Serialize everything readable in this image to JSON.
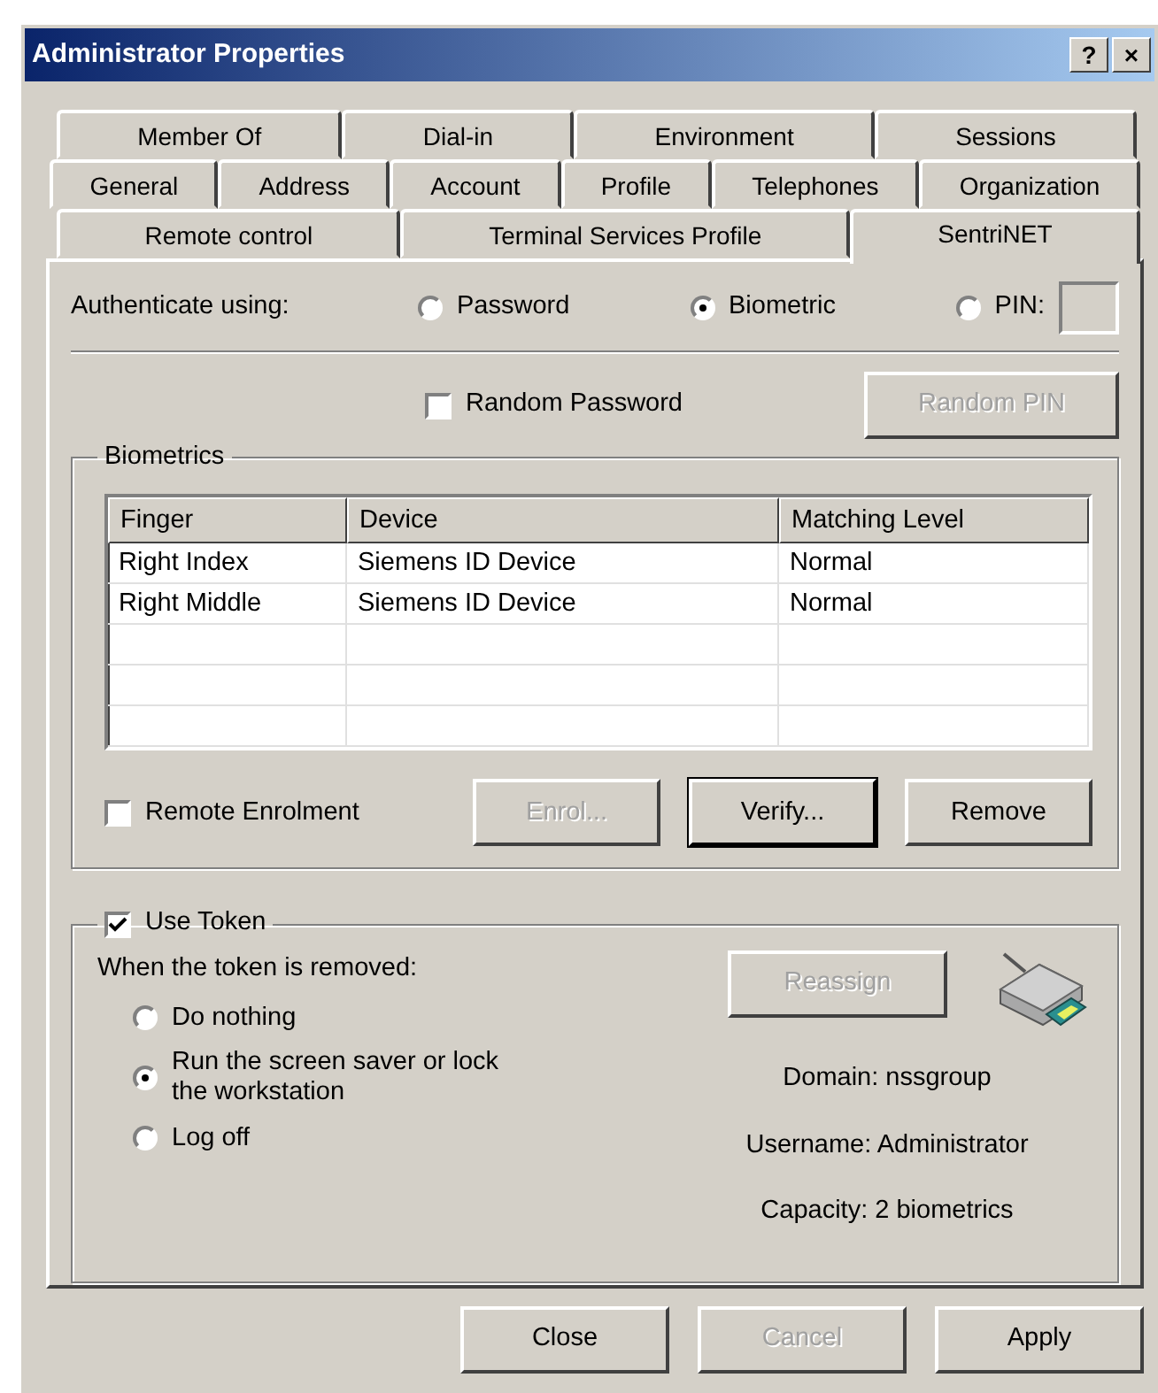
{
  "window": {
    "title": "Administrator Properties",
    "buttons": [
      "?",
      "×"
    ]
  },
  "tab_rows": [
    [
      {
        "label": "Member Of",
        "selected": false
      },
      {
        "label": "Dial-in",
        "selected": false
      },
      {
        "label": "Environment",
        "selected": false
      },
      {
        "label": "Sessions",
        "selected": false
      }
    ],
    [
      {
        "label": "General",
        "selected": false
      },
      {
        "label": "Address",
        "selected": false
      },
      {
        "label": "Account",
        "selected": false
      },
      {
        "label": "Profile",
        "selected": false
      },
      {
        "label": "Telephones",
        "selected": false
      },
      {
        "label": "Organization",
        "selected": false
      }
    ],
    [
      {
        "label": "Remote control",
        "selected": false
      },
      {
        "label": "Terminal Services Profile",
        "selected": false
      },
      {
        "label": "SentriNET",
        "selected": true
      }
    ]
  ],
  "authenticate": {
    "label": "Authenticate using:",
    "options": [
      {
        "label": "Password",
        "selected": false
      },
      {
        "label": "Biometric",
        "selected": true
      },
      {
        "label": "PIN:",
        "selected": false
      }
    ]
  },
  "random_password": {
    "label": "Random Password",
    "checked": false
  },
  "random_pin_button": {
    "label": "Random PIN",
    "disabled": true
  },
  "biometrics": {
    "title": "Biometrics",
    "table": {
      "columns": [
        "Finger",
        "Device",
        "Matching Level"
      ],
      "rows": [
        [
          "Right Index",
          "Siemens ID Device",
          "Normal"
        ],
        [
          "Right Middle",
          "Siemens ID Device",
          "Normal"
        ]
      ]
    },
    "remote_enrolment": {
      "label": "Remote Enrolment",
      "checked": false
    },
    "buttons": [
      {
        "label": "Enrol...",
        "disabled": true,
        "focused": false
      },
      {
        "label": "Verify...",
        "disabled": false,
        "focused": true
      },
      {
        "label": "Remove",
        "disabled": false,
        "focused": false
      }
    ]
  },
  "token": {
    "label": "Use Token",
    "checked": true,
    "prompt": "When the token is removed:",
    "options": [
      {
        "label": "Do nothing",
        "selected": false
      },
      {
        "label": "Run the screen saver or lock the workstation",
        "selected": true
      },
      {
        "label": "Log off",
        "selected": false
      }
    ],
    "reassign_button": {
      "label": "Reassign",
      "disabled": true
    },
    "info": [
      "Domain: nssgroup",
      "Username: Administrator",
      "Capacity: 2 biometrics"
    ]
  },
  "footer_buttons": [
    {
      "label": "Close",
      "disabled": false
    },
    {
      "label": "Cancel",
      "disabled": true
    },
    {
      "label": "Apply",
      "disabled": false
    }
  ]
}
